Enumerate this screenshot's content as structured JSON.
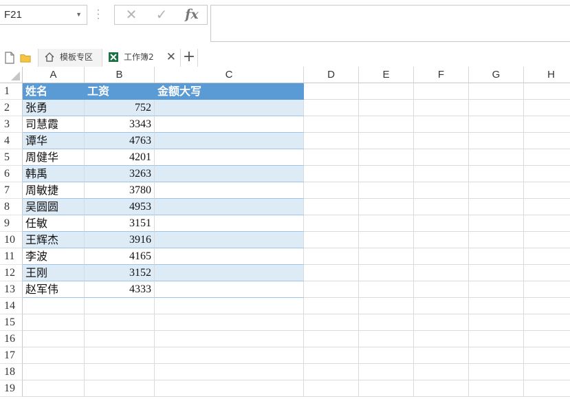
{
  "formula_bar": {
    "name_box": "F21",
    "cancel_glyph": "✕",
    "enter_glyph": "✓",
    "fx_label": "fx",
    "formula": ""
  },
  "tabs": {
    "home_label": "模板专区",
    "active_label": "工作簿2",
    "close_glyph": "✕",
    "add_glyph": "+"
  },
  "columns": [
    "A",
    "B",
    "C",
    "D",
    "E",
    "F",
    "G",
    "H"
  ],
  "rows": [
    "1",
    "2",
    "3",
    "4",
    "5",
    "6",
    "7",
    "8",
    "9",
    "10",
    "11",
    "12",
    "13",
    "14",
    "15",
    "16",
    "17",
    "18",
    "19"
  ],
  "table": {
    "headers": [
      "姓名",
      "工资",
      "金额大写"
    ],
    "data": [
      [
        "张勇",
        "752",
        ""
      ],
      [
        "司慧霞",
        "3343",
        ""
      ],
      [
        "谭华",
        "4763",
        ""
      ],
      [
        "周健华",
        "4201",
        ""
      ],
      [
        "韩禹",
        "3263",
        ""
      ],
      [
        "周敏捷",
        "3780",
        ""
      ],
      [
        "吴圆圆",
        "4953",
        ""
      ],
      [
        "任敏",
        "3151",
        ""
      ],
      [
        "王辉杰",
        "3916",
        ""
      ],
      [
        "李波",
        "4165",
        ""
      ],
      [
        "王刚",
        "3152",
        ""
      ],
      [
        "赵军伟",
        "4333",
        ""
      ]
    ]
  },
  "colors": {
    "header_fill": "#5b9bd5",
    "band_fill": "#ddebf7",
    "excel_green": "#1e7145"
  }
}
